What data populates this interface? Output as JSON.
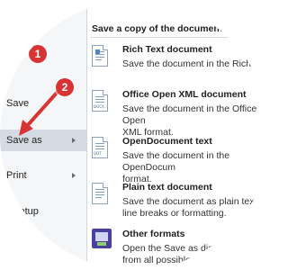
{
  "left_menu": {
    "items": [
      {
        "label": "en",
        "selected": false
      },
      {
        "label": "Save",
        "selected": false
      },
      {
        "label": "Save as",
        "selected": true,
        "has_submenu": true
      },
      {
        "label": "Print",
        "selected": false,
        "has_submenu": true
      },
      {
        "label": "setup",
        "selected": false
      }
    ]
  },
  "submenu": {
    "header": "Save a copy of the document",
    "options": [
      {
        "title": "Rich Text document",
        "description": "Save the document in the Rich Tex",
        "icon": "rtf-document-icon"
      },
      {
        "title": "Office Open XML document",
        "description": "Save the document in the Office Open\nXML format.",
        "icon": "docx-document-icon",
        "icon_tag": "DOCX"
      },
      {
        "title": "OpenDocument text",
        "description": "Save the document in the OpenDocum\nformat.",
        "icon": "odt-document-icon",
        "icon_tag": "ODT"
      },
      {
        "title": "Plain text document",
        "description": "Save the document as plain text wi\nline breaks or formatting.",
        "icon": "txt-document-icon"
      },
      {
        "title": "Other formats",
        "description": "Open the Save as dialo\nfrom all possible Co",
        "icon": "other-formats-icon"
      }
    ]
  },
  "annotations": {
    "badge_1": "1",
    "badge_2": "2",
    "color": "#d93434"
  }
}
